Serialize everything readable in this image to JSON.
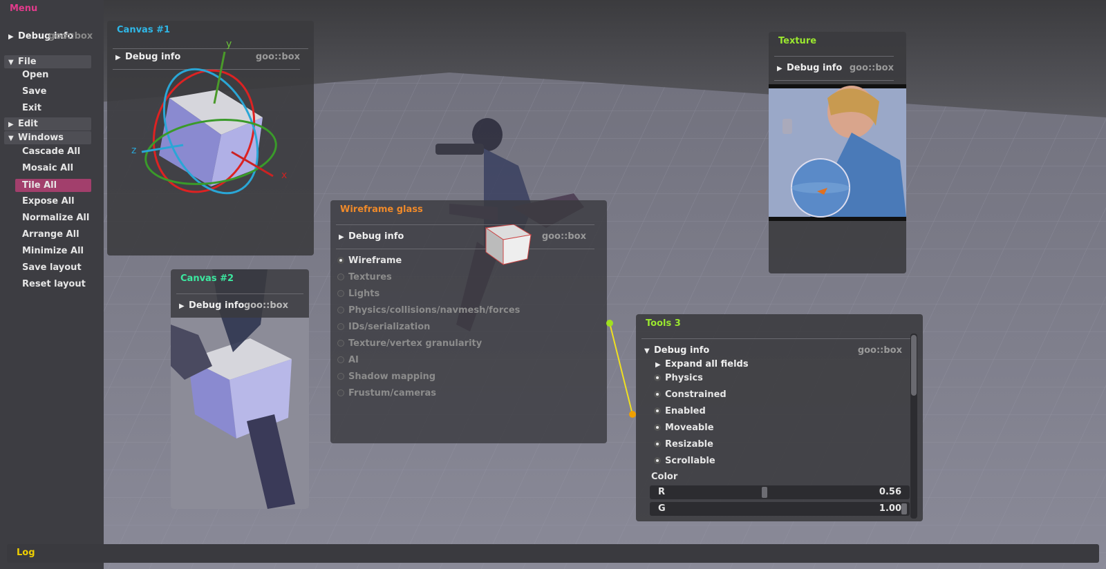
{
  "menu": {
    "title": "Menu",
    "debug_info": "Debug info",
    "debug_ghost": "goo::box",
    "file": {
      "label": "File",
      "items": [
        "Open",
        "Save",
        "Exit"
      ]
    },
    "edit": {
      "label": "Edit"
    },
    "windows": {
      "label": "Windows",
      "items": [
        "Cascade All",
        "Mosaic All",
        "Tile All",
        "Expose All",
        "Normalize All",
        "Arrange All",
        "Minimize All",
        "Save layout",
        "Reset layout"
      ],
      "selected": "Tile All"
    }
  },
  "canvas1": {
    "title": "Canvas #1",
    "debug_info": "Debug info",
    "goo": "goo::box",
    "axis_y": "y",
    "axis_z": "z",
    "axis_x": "x"
  },
  "canvas2": {
    "title": "Canvas #2",
    "debug_info": "Debug info",
    "goo": "goo::box"
  },
  "texture": {
    "title": "Texture",
    "debug_info": "Debug info",
    "goo": "goo::box"
  },
  "wireframe": {
    "title": "Wireframe glass",
    "debug_info": "Debug info",
    "goo": "goo::box",
    "options": [
      {
        "label": "Wireframe",
        "checked": true
      },
      {
        "label": "Textures",
        "checked": false
      },
      {
        "label": "Lights",
        "checked": false
      },
      {
        "label": "Physics/collisions/navmesh/forces",
        "checked": false
      },
      {
        "label": "IDs/serialization",
        "checked": false
      },
      {
        "label": "Texture/vertex granularity",
        "checked": false
      },
      {
        "label": "AI",
        "checked": false
      },
      {
        "label": "Shadow mapping",
        "checked": false
      },
      {
        "label": "Frustum/cameras",
        "checked": false
      }
    ]
  },
  "tools3": {
    "title": "Tools 3",
    "debug_info": "Debug info",
    "goo": "goo::box",
    "expand": "Expand all fields",
    "flags": [
      "Physics",
      "Constrained",
      "Enabled",
      "Moveable",
      "Resizable",
      "Scrollable"
    ],
    "color_label": "Color",
    "r": {
      "label": "R",
      "value": "0.56",
      "fraction": 0.56
    },
    "g": {
      "label": "G",
      "value": "1.00",
      "fraction": 1.0
    }
  },
  "log": {
    "title": "Log"
  },
  "colors": {
    "menu_title": "#e33b8c",
    "canvas1_title": "#2fb8e8",
    "canvas2_title": "#3ce8a0",
    "texture_title": "#9be82f",
    "wireframe_title": "#f08a2a",
    "tools3_title": "#9be82f",
    "log_title": "#f0d000"
  }
}
